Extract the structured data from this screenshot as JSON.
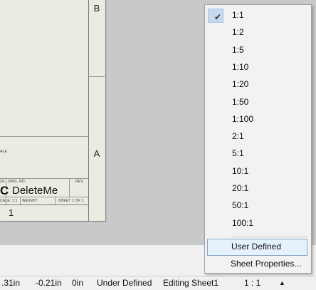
{
  "sheet": {
    "zone_letters": [
      "B",
      "A"
    ],
    "zone_number": "1",
    "title_block": {
      "size_label": "ZE",
      "dwg_no_label": "DWG. NO.",
      "rev_label": "REV",
      "size_value": "C",
      "dwg_name": "DeleteMe",
      "scale_label": "CALE: 1:1",
      "weight_label": "WEIGHT:",
      "sheet_label": "SHEET 1 OF 1",
      "ale_label": "ALE"
    }
  },
  "scale_menu": {
    "items": [
      {
        "label": "1:1",
        "checked": true
      },
      {
        "label": "1:2"
      },
      {
        "label": "1:5"
      },
      {
        "label": "1:10"
      },
      {
        "label": "1:20"
      },
      {
        "label": "1:50"
      },
      {
        "label": "1:100"
      },
      {
        "label": "2:1"
      },
      {
        "label": "5:1"
      },
      {
        "label": "10:1"
      },
      {
        "label": "20:1"
      },
      {
        "label": "50:1"
      },
      {
        "label": "100:1"
      }
    ],
    "user_defined": "User Defined",
    "sheet_properties": "Sheet Properties..."
  },
  "status_bar": {
    "x_coord": ".31in",
    "y_coord": "-0.21in",
    "z_coord": "0in",
    "state": "Under Defined",
    "editing": "Editing Sheet1",
    "scale": "1 : 1",
    "arrow": "▲"
  }
}
